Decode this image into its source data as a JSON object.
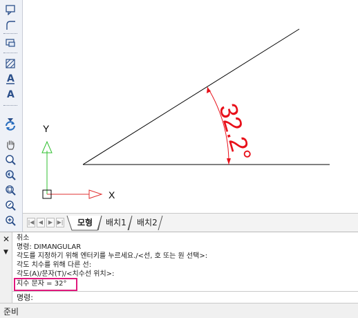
{
  "toolbar": {
    "icons": [
      "rectangle-callout-icon",
      "fillet-icon",
      "region-icon",
      "hatch-icon",
      "text-a-underline-icon",
      "text-a-icon",
      "regen-icon",
      "pan-hand-icon",
      "zoom-realtime-icon",
      "zoom-previous-icon",
      "zoom-window-icon",
      "zoom-dynamic-icon",
      "zoom-in-icon"
    ]
  },
  "drawing": {
    "dimension_text": "32.2°",
    "axis_y_label": "Y",
    "axis_x_label": "X"
  },
  "tabs": {
    "model": "모형",
    "layout1": "배치1",
    "layout2": "배치2"
  },
  "command": {
    "lines": [
      "취소",
      "명령: DIMANGULAR",
      "각도를 지정하기 위해 엔터키를 누르세요./<선, 호 또는 원 선택>:",
      "각도 치수를 위해 다른 선:",
      "각도(A)/문자(T)/<치수선 위치>:",
      "지수 문자 = 32°"
    ],
    "prompt": "명령:"
  },
  "status": {
    "text": "준비"
  },
  "colors": {
    "dimension": "#e8101a",
    "y_axis": "#2fbf2f",
    "x_axis": "#e03030",
    "highlight": "#e0177c"
  }
}
